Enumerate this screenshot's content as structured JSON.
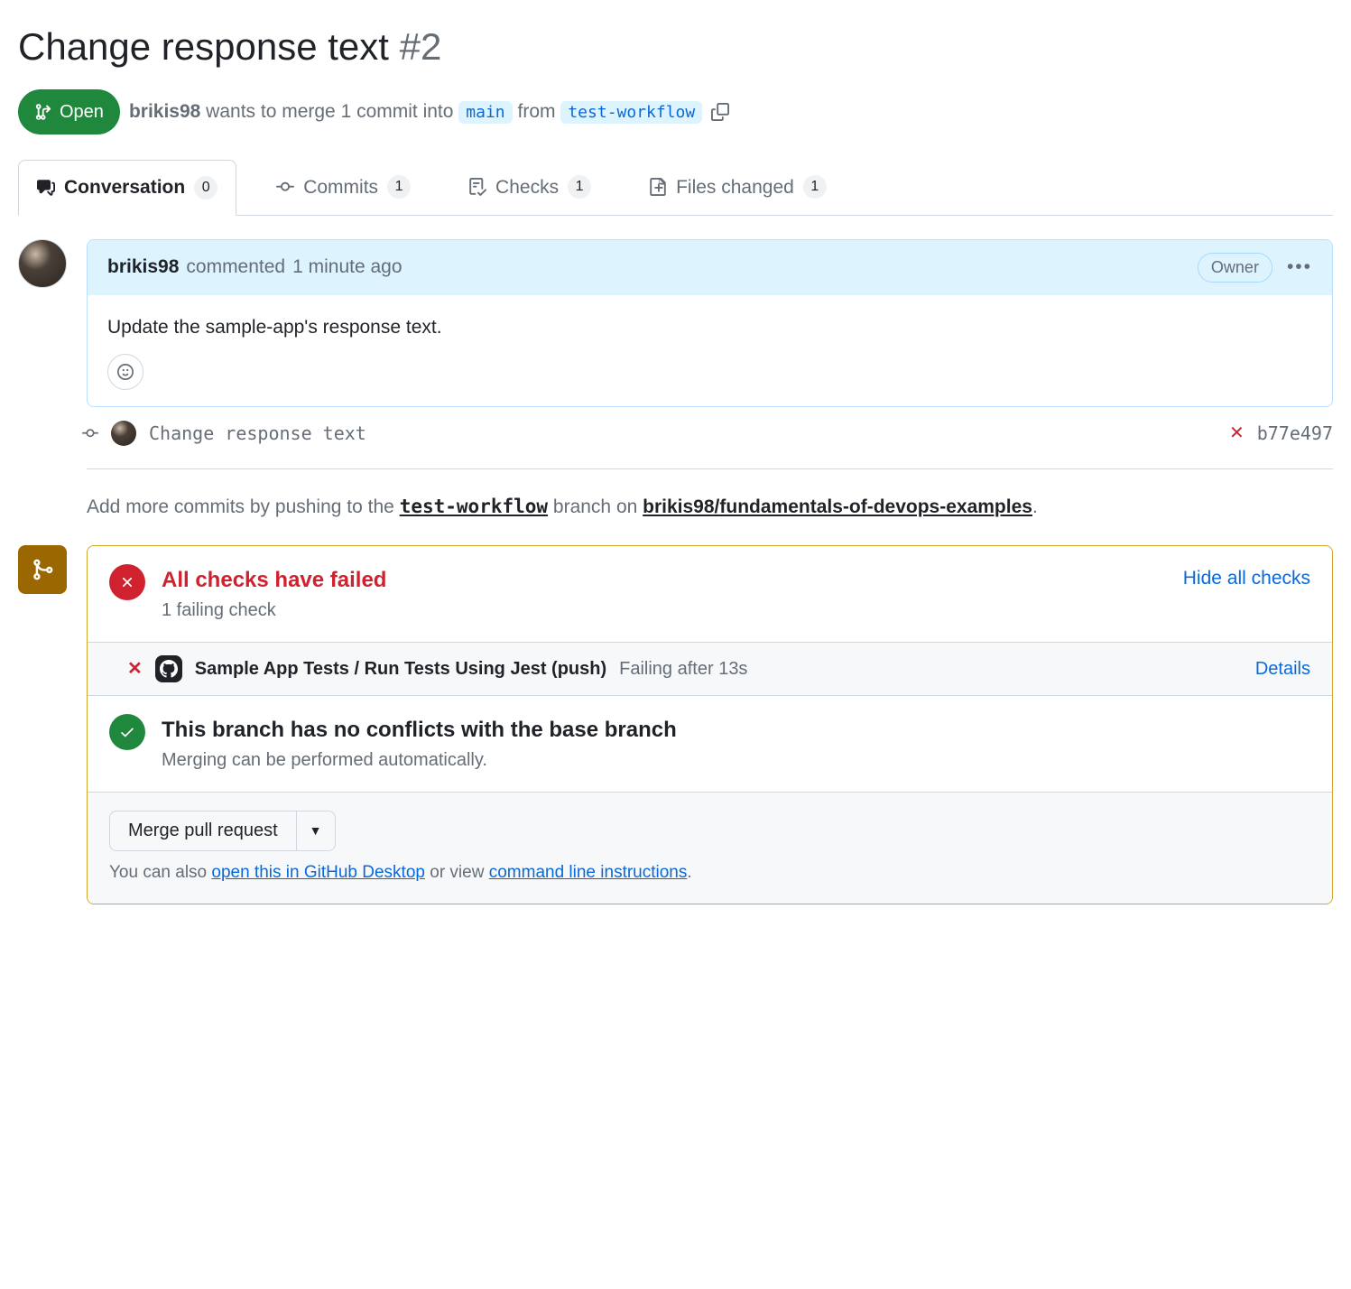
{
  "title": "Change response text",
  "number": "#2",
  "state": "Open",
  "meta": {
    "author": "brikis98",
    "text1": "wants to merge 1 commit into",
    "base_branch": "main",
    "text2": "from",
    "head_branch": "test-workflow"
  },
  "tabs": {
    "conversation": {
      "label": "Conversation",
      "count": "0"
    },
    "commits": {
      "label": "Commits",
      "count": "1"
    },
    "checks": {
      "label": "Checks",
      "count": "1"
    },
    "files": {
      "label": "Files changed",
      "count": "1"
    }
  },
  "comment": {
    "author": "brikis98",
    "action": "commented",
    "time": "1 minute ago",
    "badge": "Owner",
    "body": "Update the sample-app's response text."
  },
  "commit": {
    "message": "Change response text",
    "sha": "b77e497"
  },
  "push_hint": {
    "prefix": "Add more commits by pushing to the",
    "branch": "test-workflow",
    "middle": "branch on",
    "repo": "brikis98/fundamentals-of-devops-examples",
    "suffix": "."
  },
  "checks_panel": {
    "title": "All checks have failed",
    "sub": "1 failing check",
    "hide": "Hide all checks",
    "item": {
      "name": "Sample App Tests / Run Tests Using Jest (push)",
      "status": "Failing after 13s",
      "details": "Details"
    }
  },
  "conflict_panel": {
    "title": "This branch has no conflicts with the base branch",
    "sub": "Merging can be performed automatically."
  },
  "merge": {
    "button": "Merge pull request",
    "footnote_prefix": "You can also",
    "open_desktop": "open this in GitHub Desktop",
    "or": "or view",
    "cmdline": "command line instructions",
    "period": "."
  }
}
